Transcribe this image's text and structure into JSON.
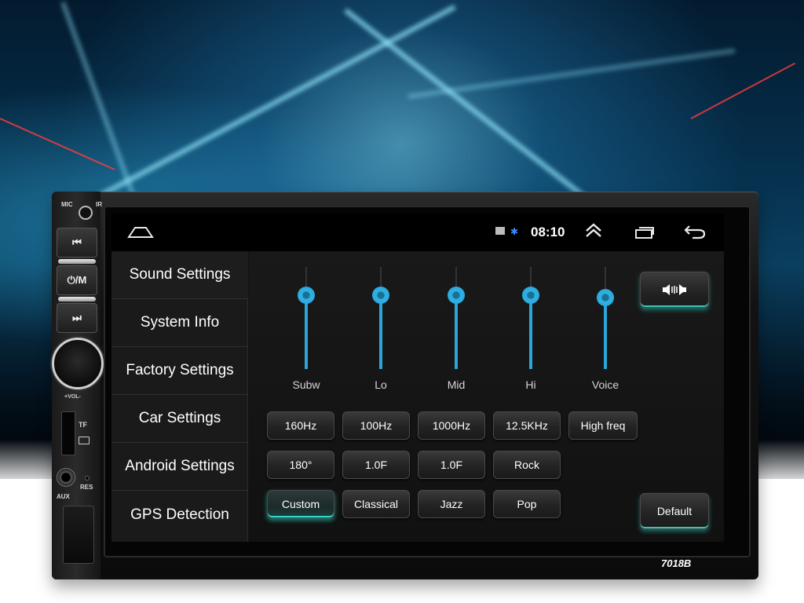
{
  "device": {
    "model": "7018B",
    "labels": {
      "mic": "MIC",
      "ir": "IR",
      "vol": "+VOL-",
      "tf": "TF",
      "res": "RES",
      "aux": "AUX"
    },
    "hw_buttons": [
      {
        "label": "⏮",
        "icon": "prev-track-icon"
      },
      {
        "label": "⏻/M",
        "icon": "power-mode-icon"
      },
      {
        "label": "⏭",
        "icon": "next-track-icon"
      }
    ]
  },
  "statusbar": {
    "time": "08:10",
    "icons": [
      "home-icon",
      "sim-icon",
      "bluetooth-icon",
      "up-arrow-icon",
      "recent-apps-icon",
      "back-icon"
    ]
  },
  "menu": {
    "items": [
      {
        "label": "Sound Settings",
        "active": true
      },
      {
        "label": "System Info"
      },
      {
        "label": "Factory Settings"
      },
      {
        "label": "Car Settings"
      },
      {
        "label": "Android Settings"
      },
      {
        "label": "GPS Detection"
      }
    ]
  },
  "equalizer": {
    "sliders": [
      {
        "label": "Subw",
        "level": 0.78
      },
      {
        "label": "Lo",
        "level": 0.78
      },
      {
        "label": "Mid",
        "level": 0.78
      },
      {
        "label": "Hi",
        "level": 0.78
      },
      {
        "label": "Voice",
        "level": 0.76
      }
    ],
    "freq_buttons": [
      "160Hz",
      "100Hz",
      "1000Hz",
      "12.5KHz",
      "High freq"
    ],
    "param_buttons": [
      "180°",
      "1.0F",
      "1.0F",
      "Rock"
    ],
    "preset_buttons": [
      "Custom",
      "Classical",
      "Jazz",
      "Pop"
    ],
    "selected_preset": "Custom",
    "balance_icon": "speaker-balance-icon",
    "default_label": "Default"
  },
  "colors": {
    "accent": "#2aa6d8",
    "selected_glow": "#3ad6c4",
    "bluetooth": "#3d8bff"
  }
}
